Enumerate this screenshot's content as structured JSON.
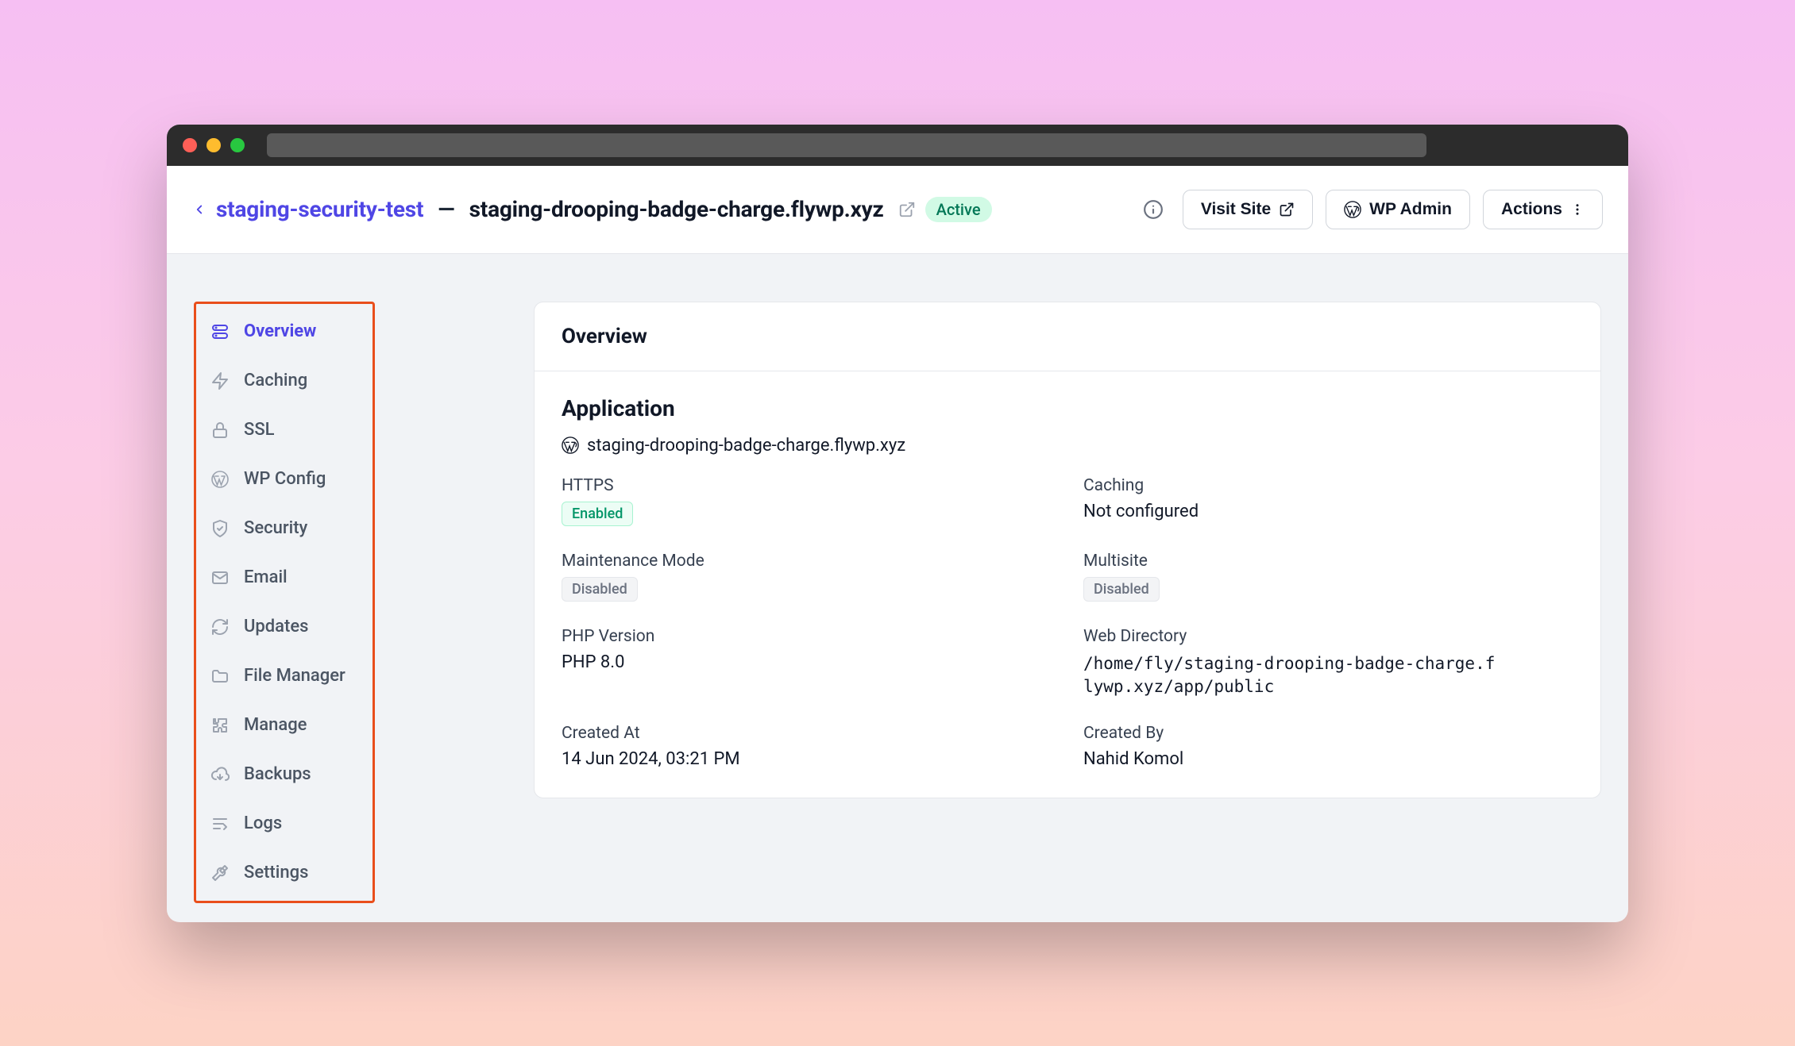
{
  "header": {
    "site_name": "staging-security-test",
    "separator": "—",
    "domain": "staging-drooping-badge-charge.flywp.xyz",
    "status": "Active",
    "visit_site": "Visit Site",
    "wp_admin": "WP Admin",
    "actions": "Actions"
  },
  "sidebar": {
    "items": [
      {
        "label": "Overview",
        "icon": "database-icon",
        "active": true
      },
      {
        "label": "Caching",
        "icon": "bolt-icon"
      },
      {
        "label": "SSL",
        "icon": "lock-icon"
      },
      {
        "label": "WP Config",
        "icon": "wordpress-icon"
      },
      {
        "label": "Security",
        "icon": "shield-icon"
      },
      {
        "label": "Email",
        "icon": "mail-icon"
      },
      {
        "label": "Updates",
        "icon": "refresh-icon"
      },
      {
        "label": "File Manager",
        "icon": "folder-icon"
      },
      {
        "label": "Manage",
        "icon": "puzzle-icon"
      },
      {
        "label": "Backups",
        "icon": "cloud-download-icon"
      },
      {
        "label": "Logs",
        "icon": "list-icon"
      },
      {
        "label": "Settings",
        "icon": "tools-icon"
      }
    ]
  },
  "panel": {
    "title": "Overview",
    "application": {
      "heading": "Application",
      "domain": "staging-drooping-badge-charge.flywp.xyz",
      "fields": {
        "https": {
          "label": "HTTPS",
          "value": "Enabled",
          "badge": "enabled"
        },
        "caching": {
          "label": "Caching",
          "value": "Not configured",
          "badge": null
        },
        "maintenance": {
          "label": "Maintenance Mode",
          "value": "Disabled",
          "badge": "disabled"
        },
        "multisite": {
          "label": "Multisite",
          "value": "Disabled",
          "badge": "disabled"
        },
        "php": {
          "label": "PHP Version",
          "value": "PHP 8.0",
          "badge": null
        },
        "webdir": {
          "label": "Web Directory",
          "value": "/home/fly/staging-drooping-badge-charge.flywp.xyz/app/public",
          "badge": null,
          "mono": true
        },
        "created_at": {
          "label": "Created At",
          "value": "14 Jun 2024, 03:21 PM",
          "badge": null
        },
        "created_by": {
          "label": "Created By",
          "value": "Nahid Komol",
          "badge": null
        }
      }
    }
  }
}
